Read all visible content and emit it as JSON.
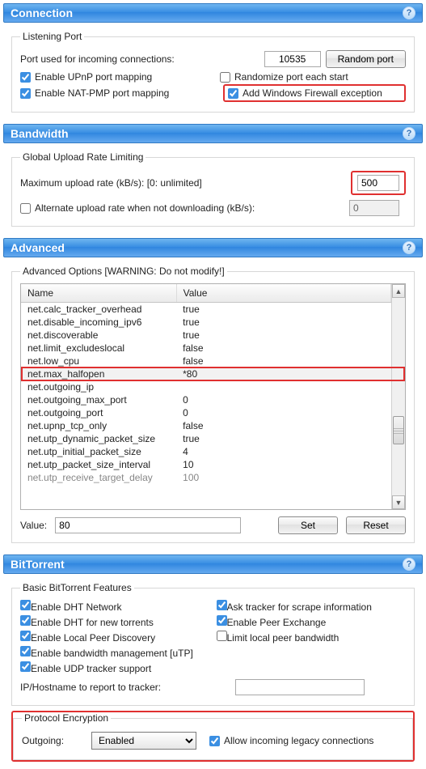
{
  "connection": {
    "title": "Connection",
    "listening_port_legend": "Listening Port",
    "port_label": "Port used for incoming connections:",
    "port_value": "10535",
    "random_port_btn": "Random port",
    "enable_upnp": "Enable UPnP port mapping",
    "enable_upnp_checked": true,
    "enable_natpmp": "Enable NAT-PMP port mapping",
    "enable_natpmp_checked": true,
    "randomize_each_start": "Randomize port each start",
    "randomize_checked": false,
    "add_firewall": "Add Windows Firewall exception",
    "add_firewall_checked": true
  },
  "bandwidth": {
    "title": "Bandwidth",
    "upload_legend": "Global Upload Rate Limiting",
    "max_upload_label": "Maximum upload rate (kB/s): [0: unlimited]",
    "max_upload_value": "500",
    "alt_upload_label": "Alternate upload rate when not downloading (kB/s):",
    "alt_upload_checked": false,
    "alt_upload_value": "0"
  },
  "advanced": {
    "title": "Advanced",
    "legend": "Advanced Options [WARNING: Do not modify!]",
    "col_name": "Name",
    "col_value": "Value",
    "rows": [
      {
        "name": "net.calc_tracker_overhead",
        "value": "true"
      },
      {
        "name": "net.disable_incoming_ipv6",
        "value": "true"
      },
      {
        "name": "net.discoverable",
        "value": "true"
      },
      {
        "name": "net.limit_excludeslocal",
        "value": "false"
      },
      {
        "name": "net.low_cpu",
        "value": "false"
      },
      {
        "name": "net.max_halfopen",
        "value": "*80"
      },
      {
        "name": "net.outgoing_ip",
        "value": ""
      },
      {
        "name": "net.outgoing_max_port",
        "value": "0"
      },
      {
        "name": "net.outgoing_port",
        "value": "0"
      },
      {
        "name": "net.upnp_tcp_only",
        "value": "false"
      },
      {
        "name": "net.utp_dynamic_packet_size",
        "value": "true"
      },
      {
        "name": "net.utp_initial_packet_size",
        "value": "4"
      },
      {
        "name": "net.utp_packet_size_interval",
        "value": "10"
      },
      {
        "name": "net.utp_receive_target_delay",
        "value": "100"
      }
    ],
    "value_label": "Value:",
    "value_input": "80",
    "set_btn": "Set",
    "reset_btn": "Reset"
  },
  "bittorrent": {
    "title": "BitTorrent",
    "basic_legend": "Basic BitTorrent Features",
    "dht_network": "Enable DHT Network",
    "dht_network_checked": true,
    "dht_new": "Enable DHT for new torrents",
    "dht_new_checked": true,
    "lpd": "Enable Local Peer Discovery",
    "lpd_checked": true,
    "utp": "Enable bandwidth management [uTP]",
    "utp_checked": true,
    "udp_tracker": "Enable UDP tracker support",
    "udp_tracker_checked": true,
    "ask_scrape": "Ask tracker for scrape information",
    "ask_scrape_checked": true,
    "pex": "Enable Peer Exchange",
    "pex_checked": true,
    "limit_local": "Limit local peer bandwidth",
    "limit_local_checked": false,
    "ip_label": "IP/Hostname to report to tracker:",
    "ip_value": "",
    "pe_legend": "Protocol Encryption",
    "outgoing_label": "Outgoing:",
    "outgoing_value": "Enabled",
    "allow_legacy": "Allow incoming legacy connections",
    "allow_legacy_checked": true
  }
}
